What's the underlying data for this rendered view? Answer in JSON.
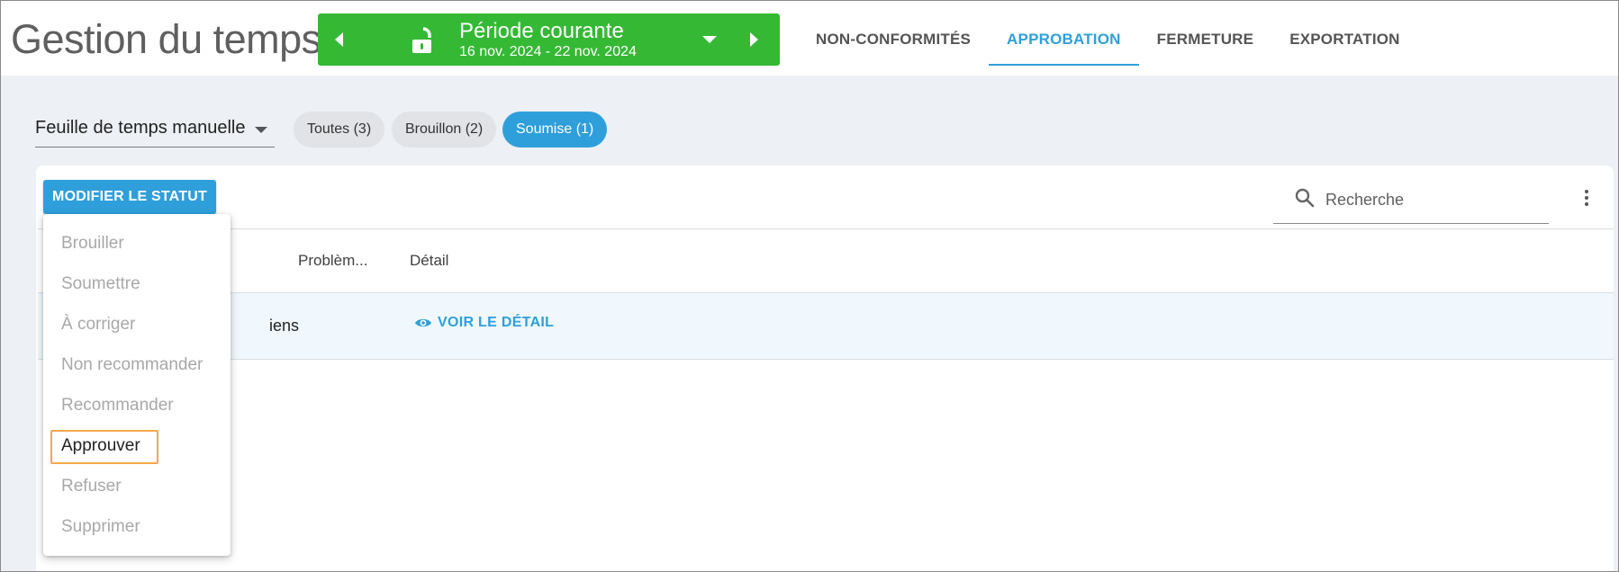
{
  "header": {
    "app_title": "Gestion du temps",
    "period": {
      "title": "Période courante",
      "range": "16 nov. 2024 - 22 nov. 2024",
      "color": "#35b935"
    },
    "tabs": [
      {
        "label": "NON-CONFORMITÉS",
        "active": false
      },
      {
        "label": "APPROBATION",
        "active": true
      },
      {
        "label": "FERMETURE",
        "active": false
      },
      {
        "label": "EXPORTATION",
        "active": false
      }
    ],
    "accent_color": "#2f9fdb"
  },
  "filters": {
    "type_select": "Feuille de temps manuelle",
    "chips": [
      {
        "label": "Toutes (3)",
        "active": false
      },
      {
        "label": "Brouillon (2)",
        "active": false
      },
      {
        "label": "Soumise (1)",
        "active": true
      }
    ]
  },
  "card": {
    "status_button": "MODIFIER LE STATUT",
    "search_placeholder": "Recherche",
    "columns": [
      "Problèm...",
      "Détail"
    ],
    "row": {
      "partial_text": "iens",
      "detail_link": "VOIR LE DÉTAIL"
    }
  },
  "status_menu": {
    "items": [
      {
        "label": "Brouiller",
        "enabled": false
      },
      {
        "label": "Soumettre",
        "enabled": false
      },
      {
        "label": "À corriger",
        "enabled": false
      },
      {
        "label": "Non recommander",
        "enabled": false
      },
      {
        "label": "Recommander",
        "enabled": false
      },
      {
        "label": "Approuver",
        "enabled": true,
        "highlighted": true
      },
      {
        "label": "Refuser",
        "enabled": false
      },
      {
        "label": "Supprimer",
        "enabled": false
      }
    ]
  }
}
